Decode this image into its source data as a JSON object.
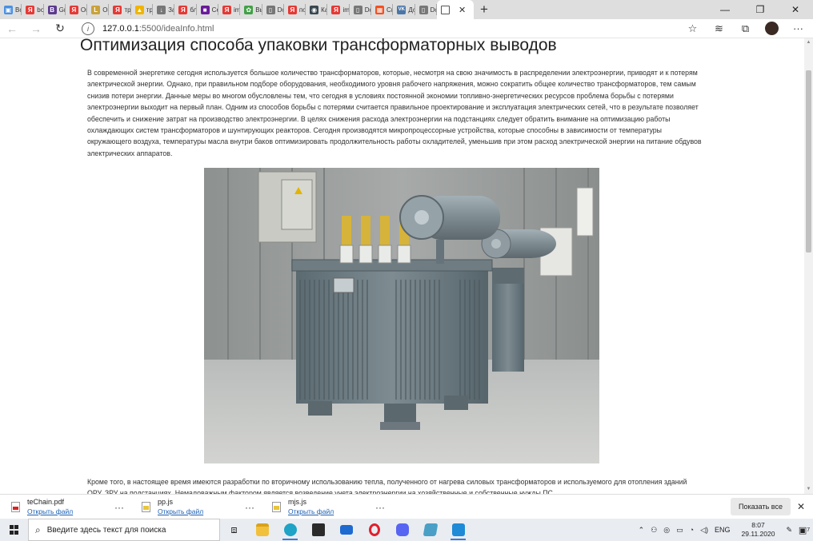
{
  "browser": {
    "tabs": [
      {
        "label": "Все",
        "color": "#4a90e2",
        "glyph": "▣"
      },
      {
        "label": "boo",
        "color": "#e53935",
        "glyph": "Я"
      },
      {
        "label": "Gric",
        "color": "#5c3a8e",
        "glyph": "B"
      },
      {
        "label": "Опт",
        "color": "#e53935",
        "glyph": "Я"
      },
      {
        "label": "Опт",
        "color": "#c8a23c",
        "glyph": "L"
      },
      {
        "label": "тра",
        "color": "#e53935",
        "glyph": "Я"
      },
      {
        "label": "тра",
        "color": "#f0b400",
        "glyph": "▲"
      },
      {
        "label": "Заг",
        "color": "#777777",
        "glyph": "↓"
      },
      {
        "label": "бло",
        "color": "#e53935",
        "glyph": "Я"
      },
      {
        "label": "Сек",
        "color": "#6a1b9a",
        "glyph": "■"
      },
      {
        "label": "ima",
        "color": "#e53935",
        "glyph": "Я"
      },
      {
        "label": "Выб",
        "color": "#43a047",
        "glyph": "✿"
      },
      {
        "label": "Doc",
        "color": "#777777",
        "glyph": "▯"
      },
      {
        "label": "под",
        "color": "#e53935",
        "glyph": "Я"
      },
      {
        "label": "Как",
        "color": "#37474f",
        "glyph": "◉"
      },
      {
        "label": "imp",
        "color": "#e53935",
        "glyph": "Я"
      },
      {
        "label": "Doc",
        "color": "#777777",
        "glyph": "▯"
      },
      {
        "label": "Спр",
        "color": "#f25022",
        "glyph": "▦"
      },
      {
        "label": "Доб",
        "color": "#4a76a8",
        "glyph": "VK"
      },
      {
        "label": "Doc",
        "color": "#777777",
        "glyph": "▯"
      }
    ],
    "active_tab_label": "",
    "new_tab": "+",
    "window_controls": [
      "—",
      "❐",
      "✕"
    ],
    "url_host": "127.0.0.1",
    "url_rest": ":5500/ideaInfo.html",
    "icons": [
      "back-icon",
      "forward-icon",
      "reload-icon",
      "info-icon",
      "favorite-star-icon",
      "favorites-list-icon",
      "collections-icon",
      "profile-avatar",
      "more-menu-icon"
    ]
  },
  "page": {
    "title": "Оптимизация способа упаковки трансформаторных выводов",
    "paragraph1": "В современной энергетике сегодня используется большое количество трансформаторов, которые, несмотря на свою значимость в распределении электроэнергии, приводят и к потерям электрической энергии. Однако, при правильном подборе оборудования, необходимого уровня рабочего напряжения, можно сократить общее количество трансформаторов, тем самым снизив потери энергии. Данные меры во многом обусловлены тем, что сегодня в условиях постоянной экономии топливно-энергетических ресурсов проблема борьбы с потерями электроэнергии выходит на первый план. Одним из способов борьбы с потерями считается правильное проектирование и эксплуатация электрических сетей, что в результате позволяет обеспечить и снижение затрат на производство электроэнергии. В целях снижения расхода электроэнергии на подстанциях следует обратить внимание на оптимизацию работы охлаждающих систем трансформаторов и шунтирующих реакторов. Сегодня производятся микропроцессорные устройства, которые способны в зависимости от температуры окружающего воздуха, температуры масла внутри баков оптимизировать продолжительность работы охладителей, уменьшив при этом расход электрической энергии на питание обдувов электрических аппаратов.",
    "paragraph2": "Кроме того, в настоящее время имеются разработки по вторичному использованию тепла, полученного от нагрева силовых трансформаторов и используемого для отопления зданий ОРУ, ЗРУ на подстанциях. Немаловажным фактором является возведение учета электроэнергии на хозяйственные и собственные нужды ПС."
  },
  "downloads": {
    "items": [
      {
        "name": "teChain.pdf",
        "action": "Открыть файл",
        "type": "pdf"
      },
      {
        "name": "pp.js",
        "action": "Открыть файл",
        "type": "js"
      },
      {
        "name": "mjs.js",
        "action": "Открыть файл",
        "type": "js"
      }
    ],
    "more": "···",
    "show_all": "Показать все",
    "close": "✕"
  },
  "taskbar": {
    "search_placeholder": "Введите здесь текст для поиска",
    "language": "ENG",
    "time": "8:07",
    "date": "29.11.2020",
    "notification_count": "7"
  }
}
